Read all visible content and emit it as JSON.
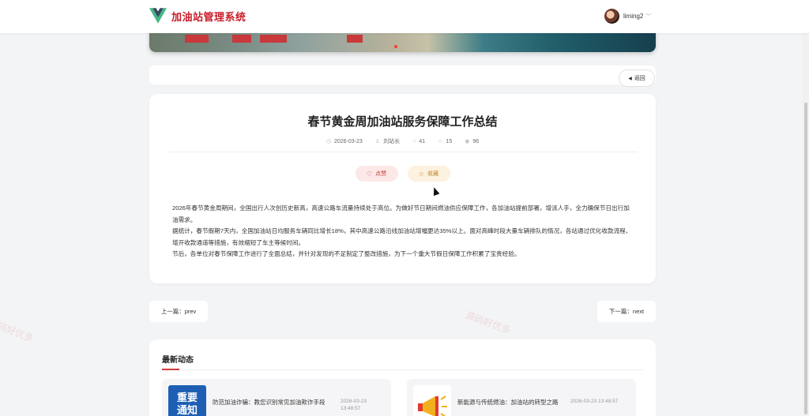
{
  "header": {
    "app_title": "加油站管理系统",
    "username": "liming2",
    "brand_color": "#c81d2a"
  },
  "nav": {
    "back_label": "返回"
  },
  "article": {
    "title": "春节黄金周加油站服务保障工作总结",
    "date": "2026-03-23",
    "author": "刘站长",
    "likes": "41",
    "favorites": "15",
    "views": "96",
    "like_label": "点赞",
    "favorite_label": "收藏",
    "paragraphs": [
      "2026年春节黄金周期间，全国出行人次创历史新高，高速公路车流量持续处于高位。为做好节日期间燃油供应保障工作，各加油站提前部署，增派人手，全力确保节日出行加油需求。",
      "据统计，春节假期7天内，全国加油站日均服务车辆同比增长18%，其中高速公路沿线加油站增幅更达35%以上。面对高峰时段大量车辆排队的情况，各站通过优化收款流程、增开收款通道等措施，有效缩短了车主等候时间。",
      "节后，各单位对春节保障工作进行了全面总结，并针对发现的不足制定了整改措施，为下一个重大节假日保障工作积累了宝贵经验。"
    ]
  },
  "pagination": {
    "prev_label": "上一篇：prev",
    "next_label": "下一篇：next"
  },
  "news": {
    "section_title": "最新动态",
    "items": [
      {
        "thumb_text_1": "重要",
        "thumb_text_2": "通知",
        "title": "防范加油诈骗：教您识别常见加油欺诈手段",
        "date": "2026-03-23",
        "time": "13:48:57"
      },
      {
        "title": "新能源与传统燃油：加油站的转型之路",
        "datetime": "2026-03-23 13:48:57"
      }
    ]
  },
  "watermark": "源码好优多",
  "icons": [
    "vue-logo-icon",
    "chevron-down-icon",
    "back-arrow-icon",
    "clock-icon",
    "user-icon",
    "thumb-up-icon",
    "star-icon",
    "eye-icon",
    "heart-icon",
    "megaphone-icon"
  ]
}
